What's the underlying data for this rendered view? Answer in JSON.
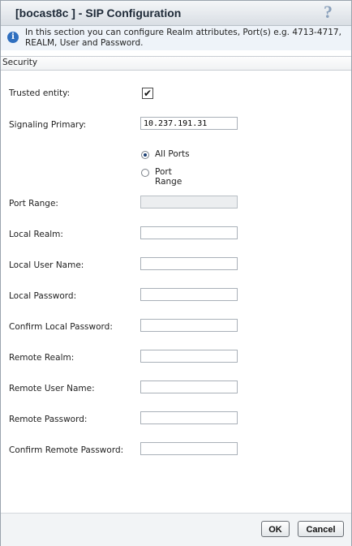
{
  "dialog": {
    "title": "[bocast8c ] - SIP Configuration",
    "help_icon": "?",
    "info_icon": "i",
    "info_text": "In this section you can configure Realm attributes, Port(s) e.g. 4713-4717, REALM, User and Password."
  },
  "section": {
    "title": "Security"
  },
  "fields": {
    "trusted_entity": {
      "label": "Trusted entity:",
      "checked": true,
      "check_glyph": "✔"
    },
    "signaling_primary": {
      "label": "Signaling Primary:",
      "value": "10.237.191.31"
    },
    "port_mode": {
      "options": [
        "All Ports",
        "Port Range"
      ],
      "selected": "All Ports"
    },
    "port_range": {
      "label": "Port Range:",
      "value": "",
      "disabled": true
    },
    "local_realm": {
      "label": "Local Realm:",
      "value": ""
    },
    "local_user_name": {
      "label": "Local User Name:",
      "value": ""
    },
    "local_password": {
      "label": "Local Password:",
      "value": ""
    },
    "confirm_local_password": {
      "label": "Confirm Local Password:",
      "value": ""
    },
    "remote_realm": {
      "label": "Remote Realm:",
      "value": ""
    },
    "remote_user_name": {
      "label": "Remote User Name:",
      "value": ""
    },
    "remote_password": {
      "label": "Remote Password:",
      "value": ""
    },
    "confirm_remote_password": {
      "label": "Confirm Remote Password:",
      "value": ""
    }
  },
  "buttons": {
    "ok": "OK",
    "cancel": "Cancel"
  },
  "colors": {
    "title_text": "#1e2a38",
    "info_background": "#eef3f9",
    "info_icon": "#2f6fbf",
    "help_icon": "#8aa0bb"
  }
}
